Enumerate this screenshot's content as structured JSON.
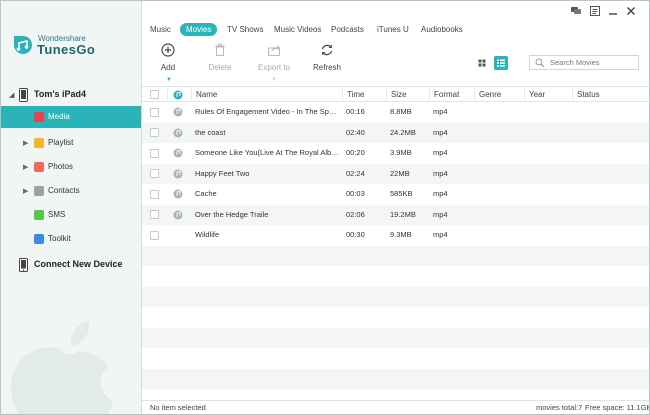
{
  "app": {
    "brand_small": "Wondershare",
    "brand_name": "TunesGo",
    "accent_color": "#2ab4b9"
  },
  "sidebar": {
    "device_label": "Tom's iPad4",
    "items": [
      {
        "label": "Media",
        "icon": "music-note-icon",
        "active": true,
        "expandable": false,
        "color": "#e8424a"
      },
      {
        "label": "Playlist",
        "icon": "playlist-icon",
        "active": false,
        "expandable": true,
        "color": "#f2b530"
      },
      {
        "label": "Photos",
        "icon": "photos-icon",
        "active": false,
        "expandable": true,
        "color": "#f06a5a"
      },
      {
        "label": "Contacts",
        "icon": "contacts-icon",
        "active": false,
        "expandable": true,
        "color": "#9aa4a6"
      },
      {
        "label": "SMS",
        "icon": "sms-icon",
        "active": false,
        "expandable": false,
        "color": "#5cc24f"
      },
      {
        "label": "Toolkit",
        "icon": "toolkit-icon",
        "active": false,
        "expandable": false,
        "color": "#3c8de0"
      }
    ],
    "connect_label": "Connect New Device"
  },
  "tabs": [
    "Music",
    "Movies",
    "TV Shows",
    "Music Videos",
    "Podcasts",
    "iTunes U",
    "Audiobooks"
  ],
  "active_tab": "Movies",
  "toolbar": {
    "add_label": "Add",
    "delete_label": "Delete",
    "export_label": "Export to",
    "refresh_label": "Refresh"
  },
  "search": {
    "placeholder": "Search Movies"
  },
  "table": {
    "headers": {
      "name": "Name",
      "time": "Time",
      "size": "Size",
      "format": "Format",
      "genre": "Genre",
      "year": "Year",
      "status": "Status"
    },
    "rows": [
      {
        "name": "Rules Of Engagement Video - In The Spotlight...",
        "time": "00:16",
        "size": "8.8MB",
        "format": "mp4",
        "genre": "",
        "year": "",
        "status": "",
        "has_icon": true
      },
      {
        "name": "the coast",
        "time": "02:40",
        "size": "24.2MB",
        "format": "mp4",
        "genre": "",
        "year": "",
        "status": "",
        "has_icon": true
      },
      {
        "name": "Someone Like You(Live At The Royal Albert H...",
        "time": "00:20",
        "size": "3.9MB",
        "format": "mp4",
        "genre": "",
        "year": "",
        "status": "",
        "has_icon": true
      },
      {
        "name": "Happy Feet Two",
        "time": "02:24",
        "size": "22MB",
        "format": "mp4",
        "genre": "",
        "year": "",
        "status": "",
        "has_icon": true
      },
      {
        "name": "Cache",
        "time": "00:03",
        "size": "585KB",
        "format": "mp4",
        "genre": "",
        "year": "",
        "status": "",
        "has_icon": true
      },
      {
        "name": "Over the Hedge Traile",
        "time": "02:06",
        "size": "19.2MB",
        "format": "mp4",
        "genre": "",
        "year": "",
        "status": "",
        "has_icon": true
      },
      {
        "name": "Wildlife",
        "time": "00:30",
        "size": "9.3MB",
        "format": "mp4",
        "genre": "",
        "year": "",
        "status": "",
        "has_icon": false
      }
    ]
  },
  "status": {
    "selection": "No item selected",
    "total": "movies total:7",
    "free": "Free space: 11.1GB"
  }
}
